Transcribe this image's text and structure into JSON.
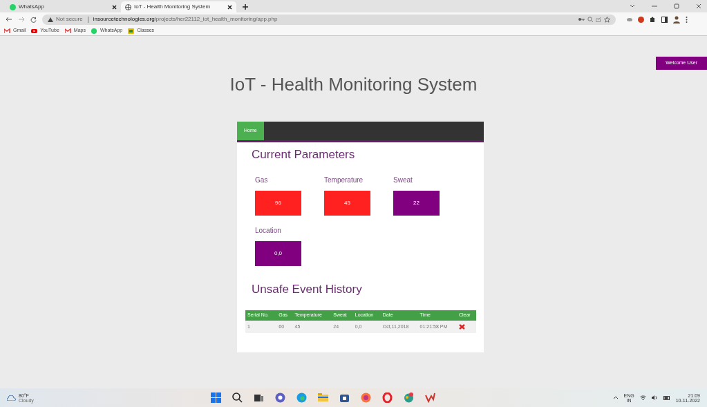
{
  "browser": {
    "tabs": [
      {
        "title": "WhatsApp",
        "selected": false
      },
      {
        "title": "IoT - Health Monitoring System",
        "selected": true
      }
    ],
    "address": {
      "security": "Not secure",
      "host": "insourcetechnologies.org",
      "path": "/projects/her22112_iot_health_monitoring/app.php"
    },
    "bookmarks": [
      "Gmail",
      "YouTube",
      "Maps",
      "WhatsApp",
      "Classes"
    ]
  },
  "page": {
    "welcome": "Welcome User",
    "title": "IoT - Health Monitoring System",
    "nav": [
      {
        "label": "Home",
        "selected": true
      }
    ],
    "parameters_heading": "Current Parameters",
    "parameters": [
      {
        "label": "Gas",
        "value": "96",
        "color": "#ff2020"
      },
      {
        "label": "Temperature",
        "value": "45",
        "color": "#ff2020"
      },
      {
        "label": "Sweat",
        "value": "22",
        "color": "#800080"
      },
      {
        "label": "Location",
        "value": "0,0",
        "color": "#800080"
      }
    ],
    "history_heading": "Unsafe Event History",
    "history": {
      "columns": [
        "Serial No.",
        "Gas",
        "Temperature",
        "Sweat",
        "Location",
        "Date",
        "Time",
        "Clear"
      ],
      "rows": [
        {
          "cells": [
            "1",
            "60",
            "45",
            "24",
            "0,0",
            "Oct,11,2018",
            "01:21:58 PM"
          ]
        }
      ]
    }
  },
  "taskbar": {
    "temperature": "80°F",
    "weather": "Cloudy",
    "language": "ENG",
    "region": "IN",
    "time": "21:09",
    "date": "10-11-2022"
  }
}
